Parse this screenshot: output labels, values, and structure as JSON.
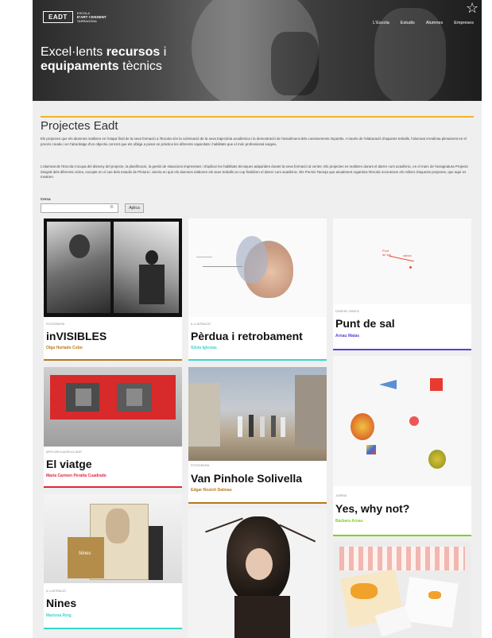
{
  "header": {
    "logo": "EADT",
    "logo_sub1": "ESCOLA",
    "logo_sub2": "D'ART I DISSENY",
    "logo_sub3": "TARRAGONA",
    "nav": [
      "L'Escola",
      "Estudis",
      "Alumnes",
      "Empreses"
    ],
    "hero_line1_light": "Excel·lents ",
    "hero_line1_bold": "recursos",
    "hero_line1_tail": " i",
    "hero_line2_bold": "equipaments",
    "hero_line2_light": " tècnics"
  },
  "page": {
    "title": "Projectes Eadt",
    "intro1": "Els projectes que els alumnes realitzen en l'etapa final de la seva formació a l'Escola són la culminació de la seva trajectòria acadèmica i la demostració de l'assoliment dels coneixements impartits. A través de l'elaboració d'aquests treballs, l'alumnat s'endinsa plenament en el procés creatiu i en l'abordatge d'un objectiu concret que els obliga a posar en pràctica les diferents capacitats i habilitats que el món professional exigeix.",
    "intro2": "L'alumnat de l'Escola s'ocupa del disseny del projecte, la planificació, la gestió de situacions imprevistes i d'aplicar les habilitats tècniques adquirides durant la seva formació al centre. Els projectes es realitzen durant el darrer curs acadèmic, en el marc de l'assignatura Projecte integral dels diferents cicles, excepte en el cas dels estudis de Pintura i Joieria en què els alumnes elaboren els seus treballs un cop finalitzen el darrer curs acadèmic. Els Premis Taronja que anualment organitza l'Escola reconeixen els millors d'aquests projectes, que aquí es mostren."
  },
  "search": {
    "label": "Cerca",
    "placeholder": "",
    "clear": "⊗",
    "button": "Aplica"
  },
  "cards": [
    {
      "category": "Fotografia",
      "title": "inVISIBLES",
      "author": "Olga Hurtado Cobo",
      "color": "#b7781a"
    },
    {
      "category": "Il·lustració",
      "title": "Pèrdua i retrobament",
      "author": "Silvia Iglesias",
      "color": "#3ad6c6"
    },
    {
      "category": "Disseny gràfic",
      "title": "Punt de sal",
      "author": "Arnau Matas",
      "color": "#5b3fd9"
    },
    {
      "category": "Arts aplicades al mur",
      "title": "El viatge",
      "author": "María Carmen Peralta Cuadrado",
      "color": "#e0283a"
    },
    {
      "category": "Fotografia",
      "title": "Van Pinhole Solivella",
      "author": "Edgar Rosich Dalmau",
      "color": "#b7781a"
    },
    {
      "category": "Joieria",
      "title": "Yes, why not?",
      "author": "Bàrbara Arnau",
      "color": "#7ed321"
    },
    {
      "category": "Il·lustració",
      "title": "Nines",
      "author": "Mariona Roig",
      "color": "#3ad6c6"
    }
  ],
  "colors": {
    "accent": "#f0b323",
    "background": "#efefef"
  }
}
